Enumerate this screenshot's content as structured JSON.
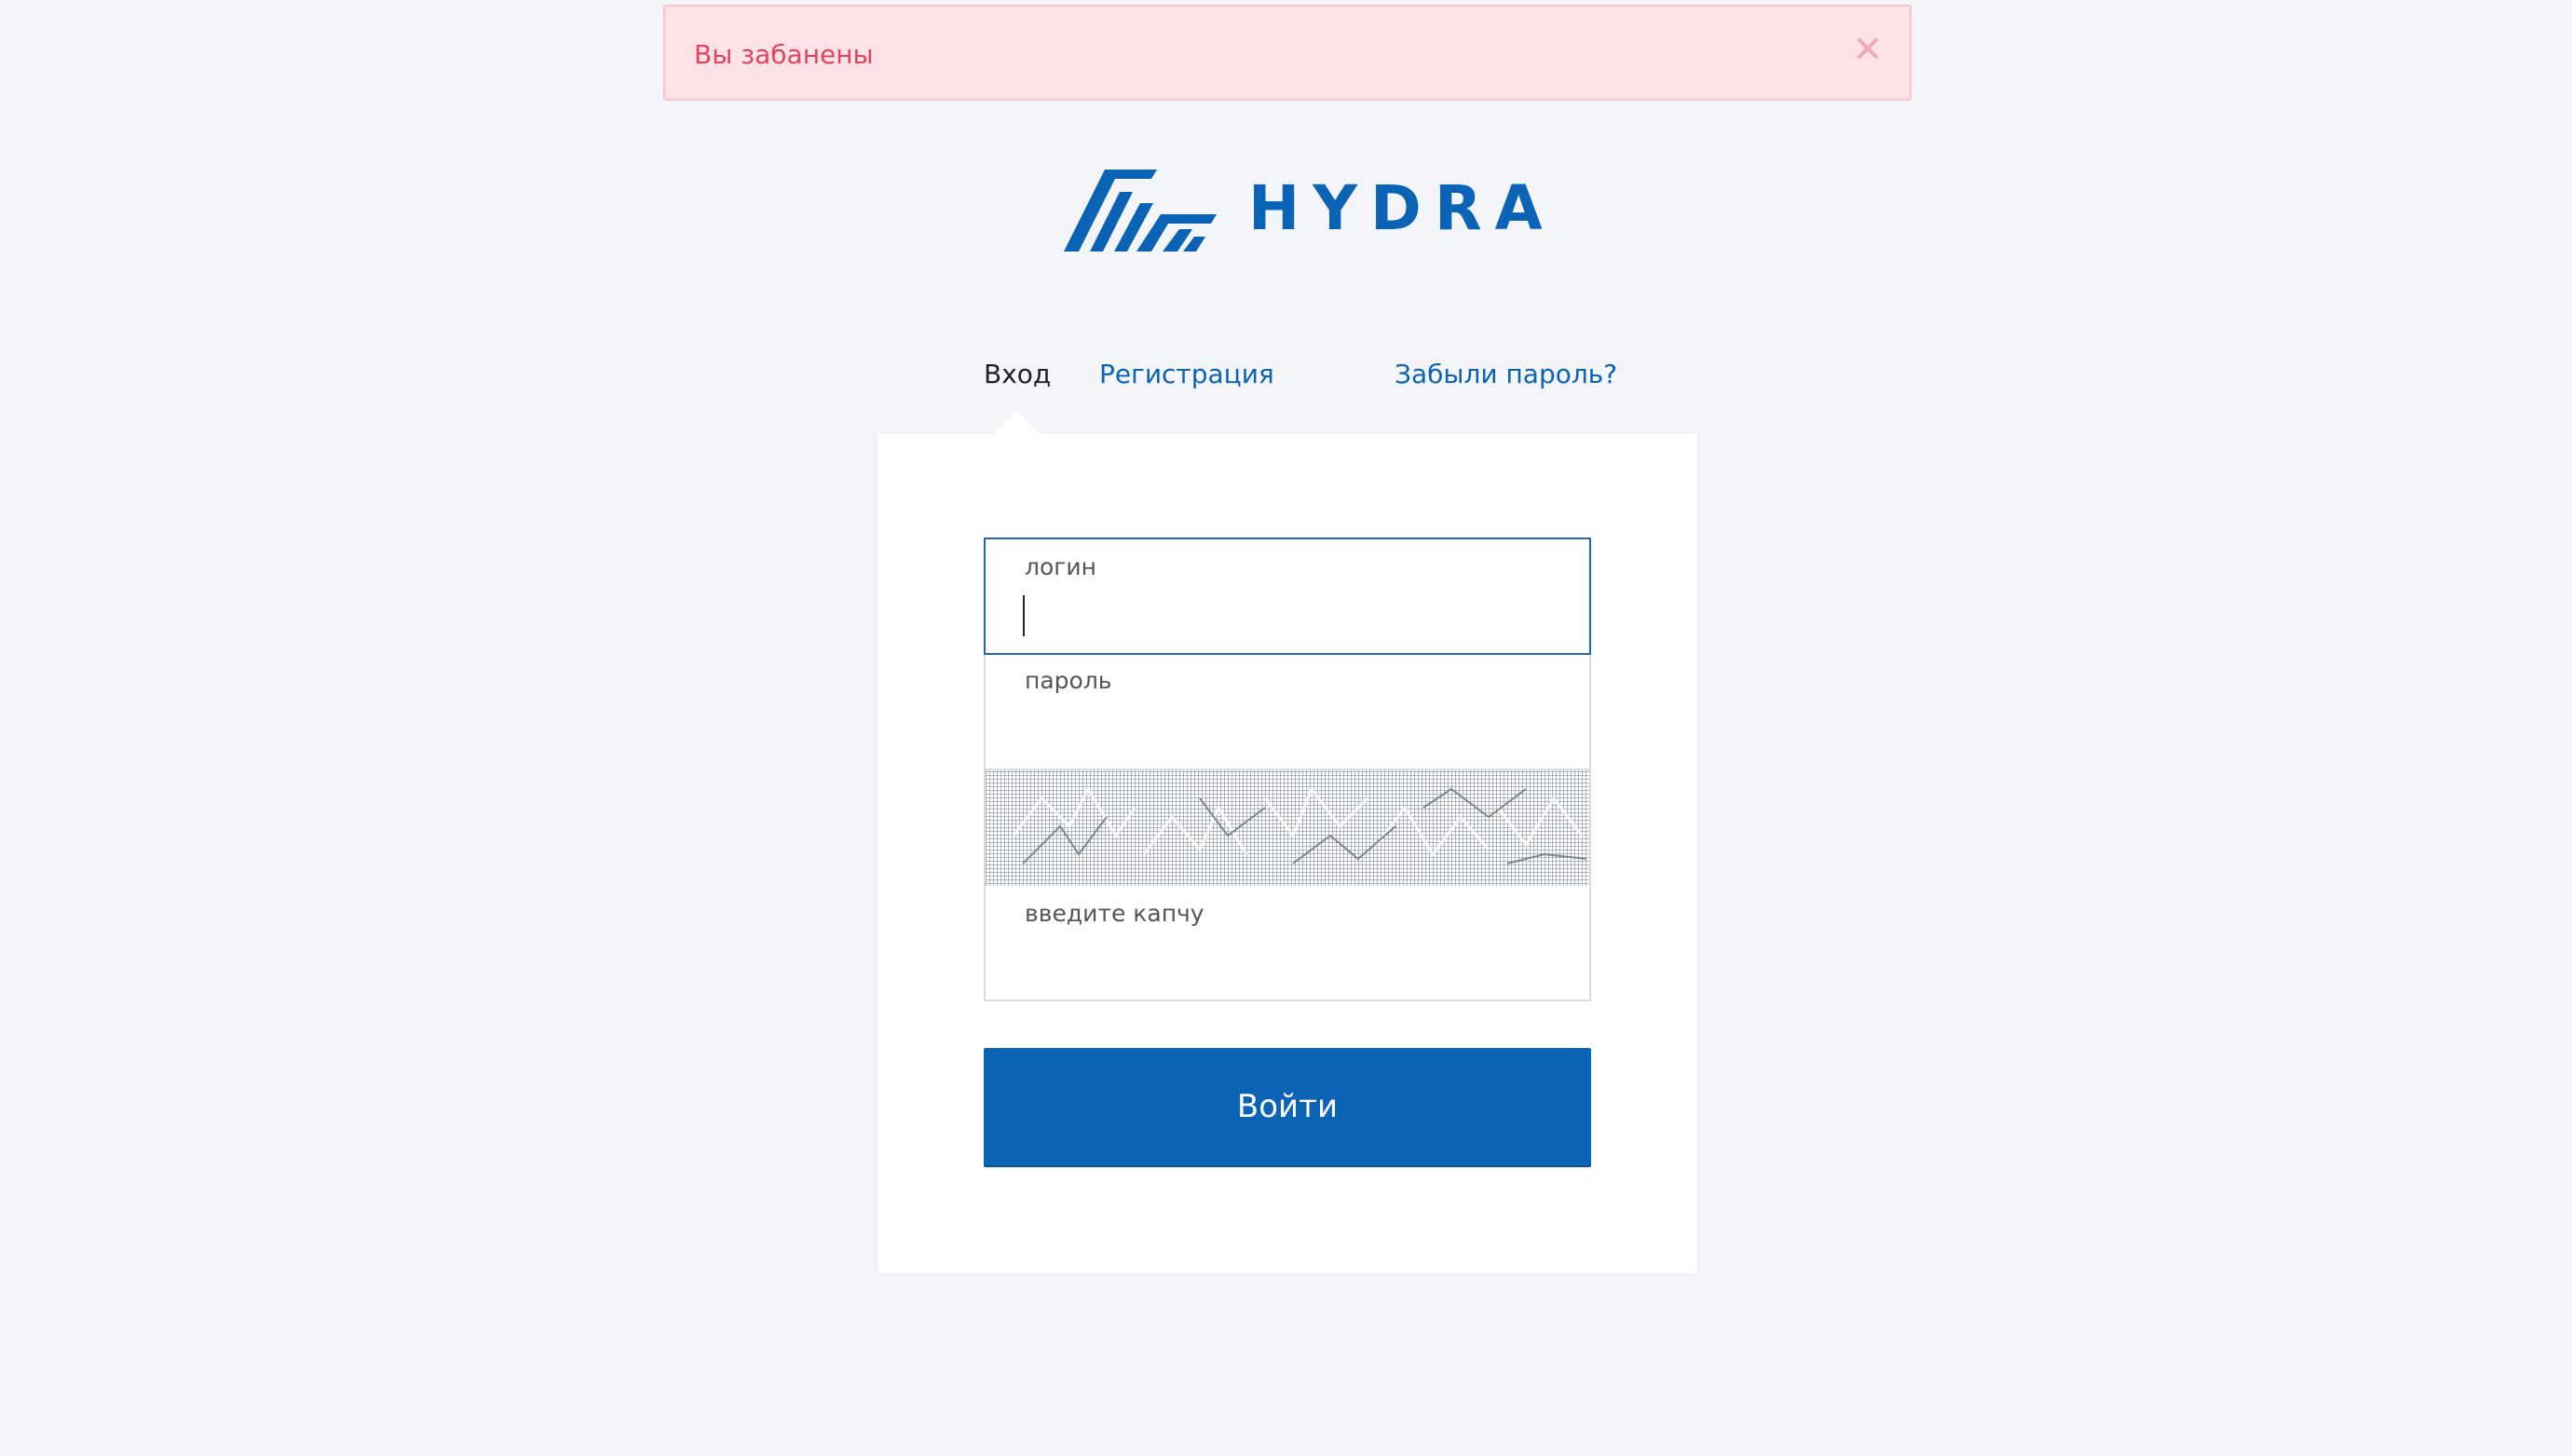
{
  "alert": {
    "message": "Вы забанены",
    "close_icon": "close-icon",
    "colors": {
      "background": "#fde3e7",
      "border": "#f7c3cc",
      "text": "#e4435e"
    }
  },
  "logo": {
    "text": "HYDRA",
    "mark_icon": "hydra-logo-icon",
    "color": "#0b63b6"
  },
  "tabs": {
    "login": "Вход",
    "register": "Регистрация",
    "forgot": "Забыли пароль?",
    "active": "login"
  },
  "form": {
    "login_label": "логин",
    "login_value": "",
    "password_label": "пароль",
    "password_value": "",
    "captcha_label": "введите капчу",
    "captcha_value": "",
    "submit_label": "Войти"
  },
  "colors": {
    "page_background": "#f3f5f9",
    "accent": "#0b63b6",
    "focus_border": "#1f6bb0"
  }
}
